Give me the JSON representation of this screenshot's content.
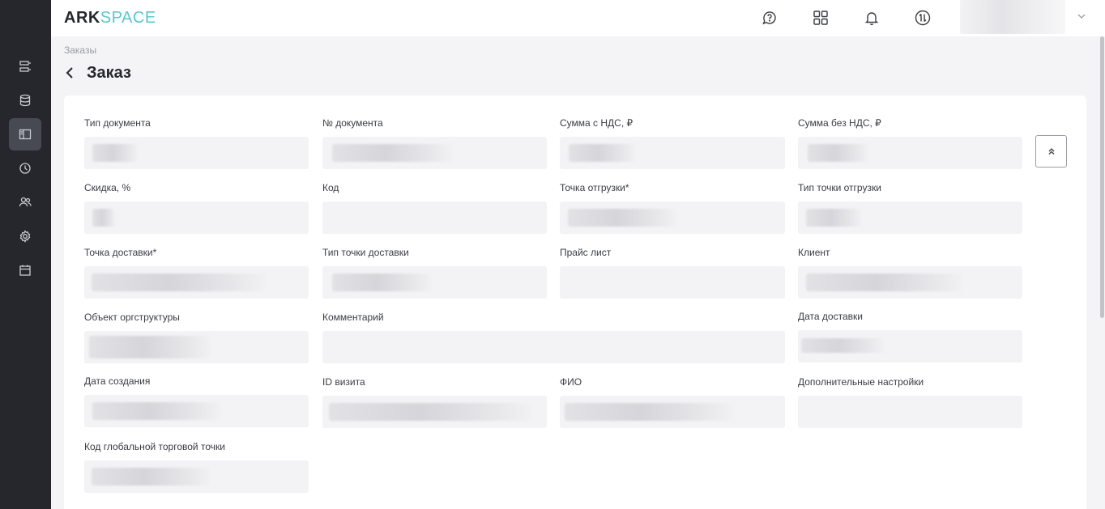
{
  "app": {
    "logo_part1": "ARK",
    "logo_part2": "SPACE"
  },
  "sidebar": {
    "items": [
      {
        "icon": "list-icon",
        "active": false
      },
      {
        "icon": "database-icon",
        "active": false
      },
      {
        "icon": "panel-icon",
        "active": true
      },
      {
        "icon": "clock-icon",
        "active": false
      },
      {
        "icon": "users-icon",
        "active": false
      },
      {
        "icon": "gear-icon",
        "active": false
      },
      {
        "icon": "calendar-icon",
        "active": false
      }
    ]
  },
  "topbar": {
    "icons": [
      "help-chat-icon",
      "apps-grid-icon",
      "bell-icon",
      "sync-icon"
    ]
  },
  "breadcrumb": "Заказы",
  "page_title": "Заказ",
  "form": {
    "fields": [
      {
        "label": "Тип документа"
      },
      {
        "label": "№ документа"
      },
      {
        "label": "Сумма с НДС, ₽"
      },
      {
        "label": "Сумма без НДС, ₽"
      },
      {
        "label": "Скидка, %"
      },
      {
        "label": "Код"
      },
      {
        "label": "Точка отгрузки*"
      },
      {
        "label": "Тип точки отгрузки"
      },
      {
        "label": "Точка доставки*"
      },
      {
        "label": "Тип точки доставки"
      },
      {
        "label": "Прайс лист"
      },
      {
        "label": "Клиент"
      },
      {
        "label": "Объект оргструктуры"
      },
      {
        "label": "Комментарий"
      },
      {
        "label": "Дата доставки"
      },
      {
        "label": "Дата создания"
      },
      {
        "label": "ID визита"
      },
      {
        "label": "ФИО"
      },
      {
        "label": "Дополнительные настройки"
      },
      {
        "label": "Код глобальной торговой точки"
      }
    ]
  }
}
